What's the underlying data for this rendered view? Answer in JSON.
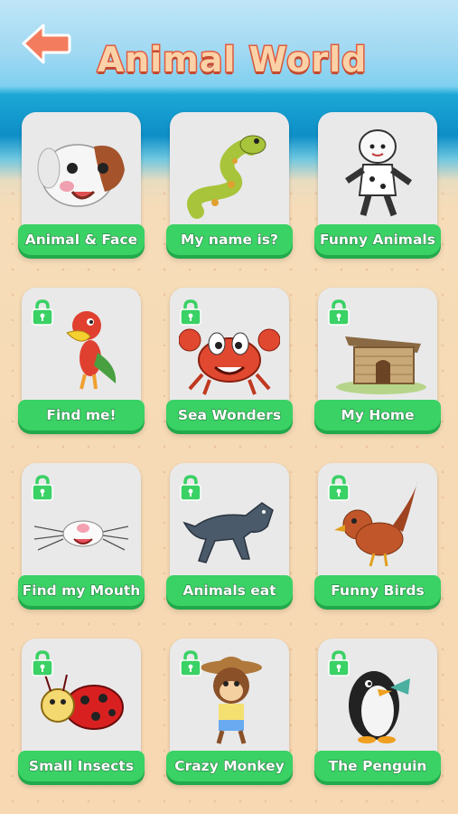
{
  "header": {
    "title": "Animal World",
    "back_icon": "arrow-left-icon"
  },
  "colors": {
    "label_green": "#3ad165",
    "title_fill": "#fbd2a7",
    "title_stroke": "#e25c3f",
    "back_arrow": "#f47c5e"
  },
  "cards": [
    {
      "label": "Animal & Face",
      "locked": false,
      "icon": "dog-icon"
    },
    {
      "label": "My name is?",
      "locked": false,
      "icon": "snake-icon"
    },
    {
      "label": "Funny Animals",
      "locked": false,
      "icon": "boy-in-dog-costume-icon"
    },
    {
      "label": "Find me!",
      "locked": true,
      "icon": "parrot-icon"
    },
    {
      "label": "Sea Wonders",
      "locked": true,
      "icon": "crab-icon"
    },
    {
      "label": "My Home",
      "locked": true,
      "icon": "wooden-hut-icon"
    },
    {
      "label": "Find my Mouth",
      "locked": true,
      "icon": "mouse-face-icon"
    },
    {
      "label": "Animals eat",
      "locked": true,
      "icon": "wolf-icon"
    },
    {
      "label": "Funny Birds",
      "locked": true,
      "icon": "bird-icon"
    },
    {
      "label": "Small Insects",
      "locked": true,
      "icon": "ladybug-icon"
    },
    {
      "label": "Crazy Monkey",
      "locked": true,
      "icon": "monkey-icon"
    },
    {
      "label": "The Penguin",
      "locked": true,
      "icon": "penguin-icon"
    }
  ]
}
